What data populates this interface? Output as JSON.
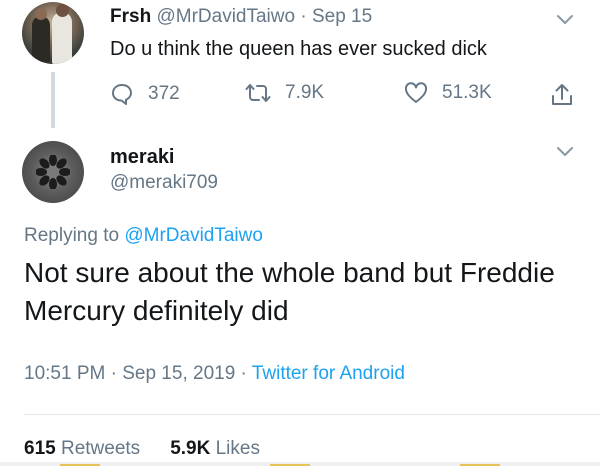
{
  "parent_tweet": {
    "display_name": "Frsh",
    "handle": "@MrDavidTaiwo",
    "separator": "·",
    "date": "Sep 15",
    "text": "Do u think the queen has ever sucked dick",
    "actions": {
      "reply_count": "372",
      "retweet_count": "7.9K",
      "like_count": "51.3K"
    }
  },
  "reply_tweet": {
    "display_name": "meraki",
    "handle": "@meraki709",
    "replying_prefix": "Replying to ",
    "replying_to": "@MrDavidTaiwo",
    "text": "Not sure about the whole band but Freddie Mercury definitely did",
    "time": "10:51 PM",
    "separator": "·",
    "date": "Sep 15, 2019",
    "separator2": "·",
    "source": "Twitter for Android",
    "stats": {
      "retweets_count": "615",
      "retweets_label": "Retweets",
      "likes_count": "5.9K",
      "likes_label": "Likes"
    }
  },
  "icons": {
    "reply": "reply-icon",
    "retweet": "retweet-icon",
    "like": "heart-icon",
    "share": "share-icon",
    "menu": "chevron-down-icon"
  },
  "colors": {
    "text": "#14171a",
    "secondary": "#657786",
    "link": "#1da1f2",
    "divider": "#e1e8ed"
  }
}
